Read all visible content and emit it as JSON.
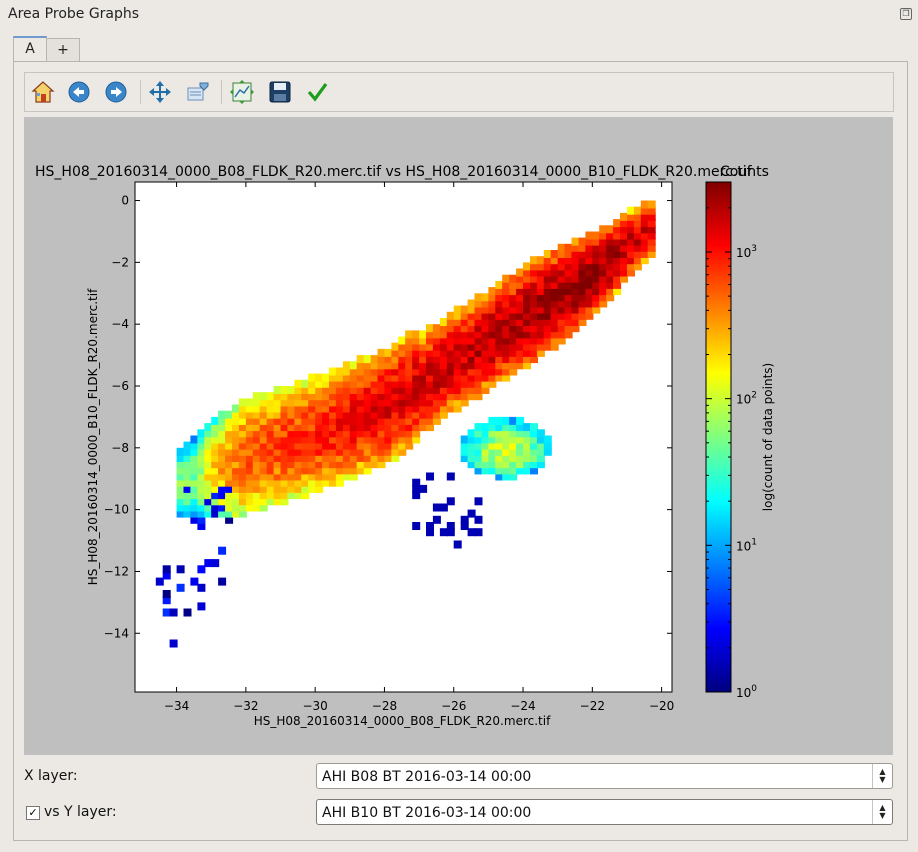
{
  "window": {
    "title": "Area Probe Graphs"
  },
  "tabs": [
    {
      "label": "A"
    },
    {
      "label": "+"
    }
  ],
  "toolbar": {
    "icons": [
      "home-icon",
      "back-arrow-icon",
      "forward-arrow-icon",
      "pan-icon",
      "zoom-icon",
      "configure-subplots-icon",
      "save-icon",
      "check-icon"
    ]
  },
  "chart_data": {
    "type": "heatmap",
    "title": "HS_H08_20160314_0000_B08_FLDK_R20.merc.tif vs HS_H08_20160314_0000_B10_FLDK_R20.merc.tif",
    "title_overlap_fragment": "Counts",
    "xlabel": "HS_H08_20160314_0000_B08_FLDK_R20.merc.tif",
    "ylabel": "HS_H08_20160314_0000_B10_FLDK_R20.merc.tif",
    "xlim": [
      -35.2,
      -19.7
    ],
    "ylim": [
      -15.9,
      0.6
    ],
    "x_ticks": [
      -34,
      -32,
      -30,
      -28,
      -26,
      -24,
      -22,
      -20
    ],
    "y_ticks": [
      0,
      -2,
      -4,
      -6,
      -8,
      -10,
      -12,
      -14
    ],
    "colorbar": {
      "label": "log(count of data points)",
      "scale": "log",
      "range": [
        1,
        3000
      ],
      "ticks": [
        {
          "base": "10",
          "exp": "0",
          "value": 1
        },
        {
          "base": "10",
          "exp": "1",
          "value": 10
        },
        {
          "base": "10",
          "exp": "2",
          "value": 100
        },
        {
          "base": "10",
          "exp": "3",
          "value": 1000
        }
      ]
    },
    "density_ridge": [
      {
        "x": -33.5,
        "y": -9.0,
        "count": 60
      },
      {
        "x": -32.0,
        "y": -8.3,
        "count": 600
      },
      {
        "x": -30.0,
        "y": -7.6,
        "count": 900
      },
      {
        "x": -28.0,
        "y": -6.7,
        "count": 1500
      },
      {
        "x": -26.0,
        "y": -5.2,
        "count": 1800
      },
      {
        "x": -24.0,
        "y": -3.8,
        "count": 2300
      },
      {
        "x": -22.0,
        "y": -2.4,
        "count": 2800
      },
      {
        "x": -20.5,
        "y": -1.0,
        "count": 1500
      }
    ]
  },
  "controls": {
    "x_layer_label": "X layer:",
    "x_layer_value": "AHI B08 BT 2016-03-14 00:00",
    "y_layer_label": "vs Y layer:",
    "y_layer_value": "AHI B10 BT 2016-03-14 00:00",
    "y_layer_checked": true
  }
}
